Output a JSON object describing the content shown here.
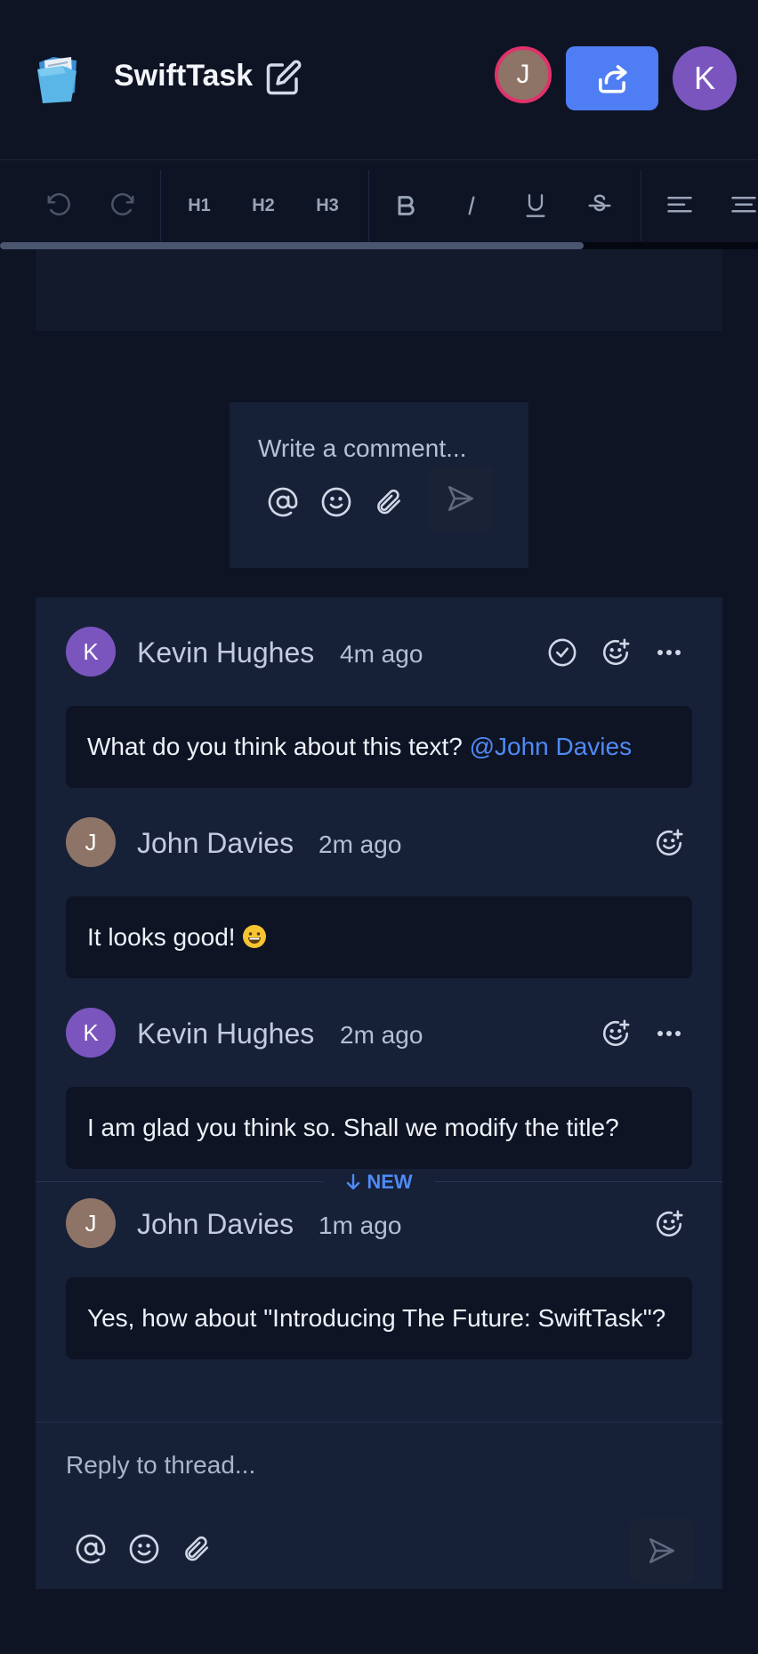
{
  "header": {
    "app_title": "SwiftTask",
    "user_initial_1": "J",
    "user_initial_2": "K",
    "colors": {
      "accent": "#4f7df3",
      "presence_ring": "#e0326a"
    }
  },
  "toolbar": {
    "h1": "H1",
    "h2": "H2",
    "h3": "H3"
  },
  "composer": {
    "placeholder": "Write a comment..."
  },
  "thread": {
    "comments": [
      {
        "initial": "K",
        "author": "Kevin Hughes",
        "time": "4m ago",
        "text": "What do you think about this text?",
        "mention": "@John Davies"
      },
      {
        "initial": "J",
        "author": "John Davies",
        "time": "2m ago",
        "text": "It looks good!"
      },
      {
        "initial": "K",
        "author": "Kevin Hughes",
        "time": "2m ago",
        "text": "I am glad you think so. Shall we modify the title?"
      },
      {
        "initial": "J",
        "author": "John Davies",
        "time": "1m ago",
        "text": "Yes, how about \"Introducing The Future: SwiftTask\"?"
      }
    ],
    "new_label": "NEW",
    "reply_placeholder": "Reply to thread..."
  }
}
